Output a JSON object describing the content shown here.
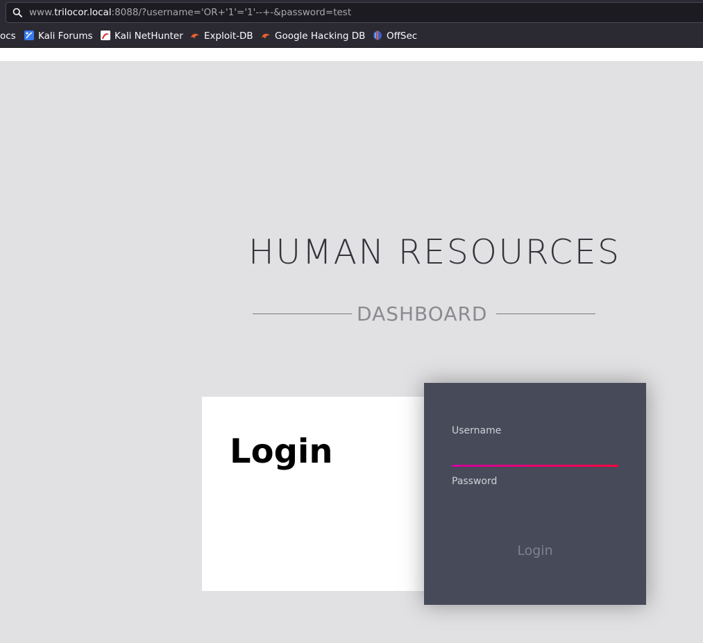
{
  "browser": {
    "url": {
      "prefix": "www.",
      "host": "trilocor.local",
      "suffix": ":8088/?username='OR+'1'='1'--+-&password=test"
    },
    "bookmarks": [
      {
        "label": "ocs",
        "icon": "none"
      },
      {
        "label": "Kali Forums",
        "icon": "kali-forums-icon"
      },
      {
        "label": "Kali NetHunter",
        "icon": "kali-nethunter-icon"
      },
      {
        "label": "Exploit-DB",
        "icon": "exploit-db-icon"
      },
      {
        "label": "Google Hacking DB",
        "icon": "exploit-db-icon"
      },
      {
        "label": "OffSec",
        "icon": "offsec-icon"
      }
    ]
  },
  "page": {
    "title": "HUMAN RESOURCES",
    "subtitle": "DASHBOARD",
    "login_heading": "Login",
    "form": {
      "username_label": "Username",
      "username_value": "",
      "password_label": "Password",
      "password_value": "",
      "submit_label": "Login"
    }
  },
  "colors": {
    "page_bg": "#e1e1e3",
    "form_bg": "#474a59",
    "underline_start": "#d0009e",
    "underline_end": "#ff0040"
  }
}
